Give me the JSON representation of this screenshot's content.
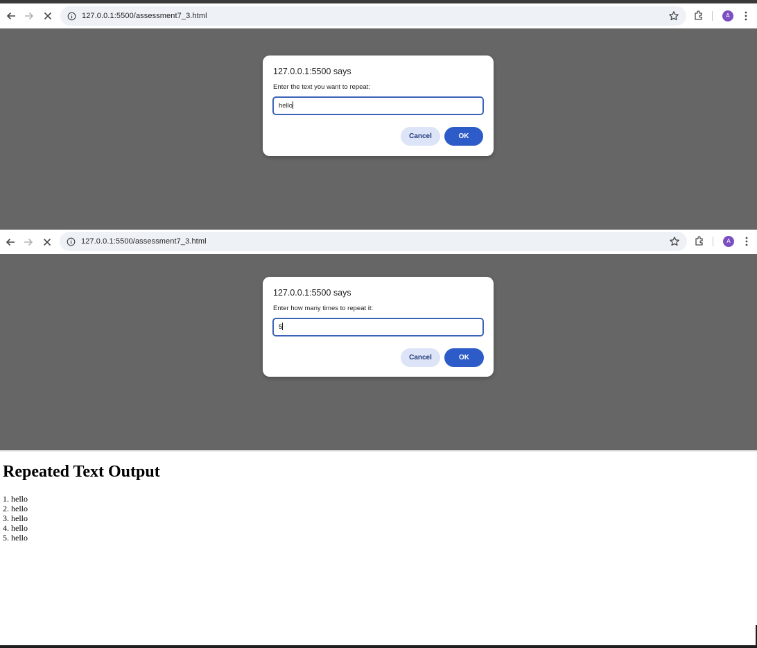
{
  "browser_windows": [
    {
      "url": "127.0.0.1:5500/assessment7_3.html",
      "avatar_letter": "A",
      "dialog": {
        "title": "127.0.0.1:5500 says",
        "message": "Enter the text you want to repeat:",
        "input_value": "hello",
        "cancel_label": "Cancel",
        "ok_label": "OK"
      }
    },
    {
      "url": "127.0.0.1:5500/assessment7_3.html",
      "avatar_letter": "A",
      "dialog": {
        "title": "127.0.0.1:5500 says",
        "message": "Enter how many times to repeat it:",
        "input_value": "5",
        "cancel_label": "Cancel",
        "ok_label": "OK"
      }
    }
  ],
  "page": {
    "heading": "Repeated Text Output",
    "items": [
      "1. hello",
      "2. hello",
      "3. hello",
      "4. hello",
      "5. hello"
    ]
  },
  "colors": {
    "overlay": "#666666",
    "ok_button": "#2d5bc8",
    "cancel_button": "#dde4f7",
    "input_border": "#3d63b8",
    "avatar": "#7b4fc2"
  },
  "icons": [
    "back-arrow-icon",
    "forward-arrow-icon",
    "stop-loading-icon",
    "site-info-icon",
    "bookmark-star-icon",
    "extensions-icon",
    "more-menu-icon"
  ]
}
